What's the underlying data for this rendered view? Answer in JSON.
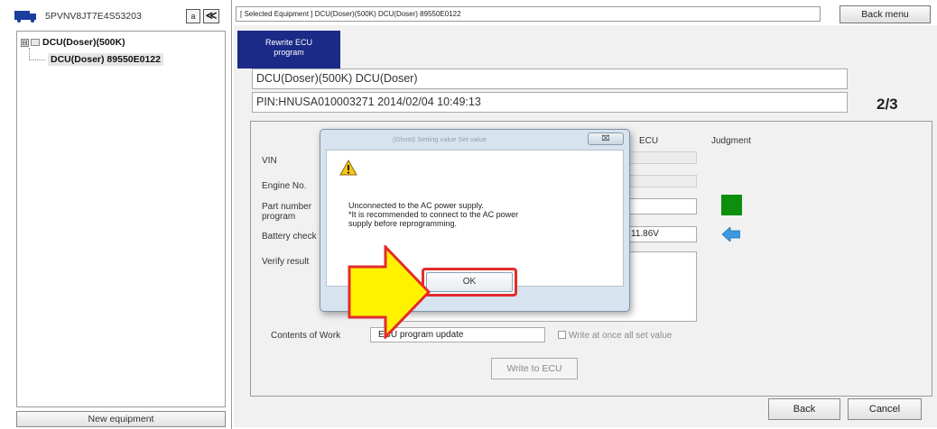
{
  "left_pane": {
    "vin": "5PVNV8JT7E4S53203",
    "btn_a_label": "a",
    "btn_collapse_label": "≪",
    "tree": {
      "root_expander": "⊟",
      "root_label": "DCU(Doser)(500K)",
      "child_label": "DCU(Doser) 89550E0122"
    },
    "new_equipment_label": "New equipment"
  },
  "header": {
    "selected_equipment": "[ Selected Equipment ] DCU(Doser)(500K) DCU(Doser) 89550E0122",
    "back_menu_label": "Back menu"
  },
  "tab": {
    "line1": "Rewrite ECU",
    "line2": "program"
  },
  "info": {
    "name_line": "DCU(Doser)(500K) DCU(Doser)",
    "pin_line": "PIN:HNUSA010003271 2014/02/04 10:49:13",
    "step": "2/3"
  },
  "form": {
    "col_ecu": "ECU",
    "col_judgment": "Judgment",
    "vin_label": "VIN",
    "engine_label": "Engine No.",
    "part_label_1": "Part number",
    "part_label_2": "program",
    "battery_label": "Battery check",
    "battery_value": "11.86V",
    "verify_label": "Verify result",
    "contents_label": "Contents of Work",
    "contents_value": "ECU program update",
    "write_all_label": "Write at once all set value",
    "write_ecu_label": "Write to ECU"
  },
  "colors": {
    "tab_bg": "#1a2a86",
    "judgment_ok": "#0d8f0d",
    "arrow_blue": "#3a9be0",
    "highlight_red": "#e32c2c",
    "pointer_yellow": "#fff200"
  },
  "dialog": {
    "ghost_title": "(Ghost) Setting value      Set value",
    "close_label": "⌧",
    "message_line1": "Unconnected to the AC power supply.",
    "message_line2": "*It is recommended to connect to the AC power",
    "message_line3": "supply before reprogramming.",
    "ok_label": "OK"
  },
  "footer": {
    "back_label": "Back",
    "cancel_label": "Cancel"
  }
}
